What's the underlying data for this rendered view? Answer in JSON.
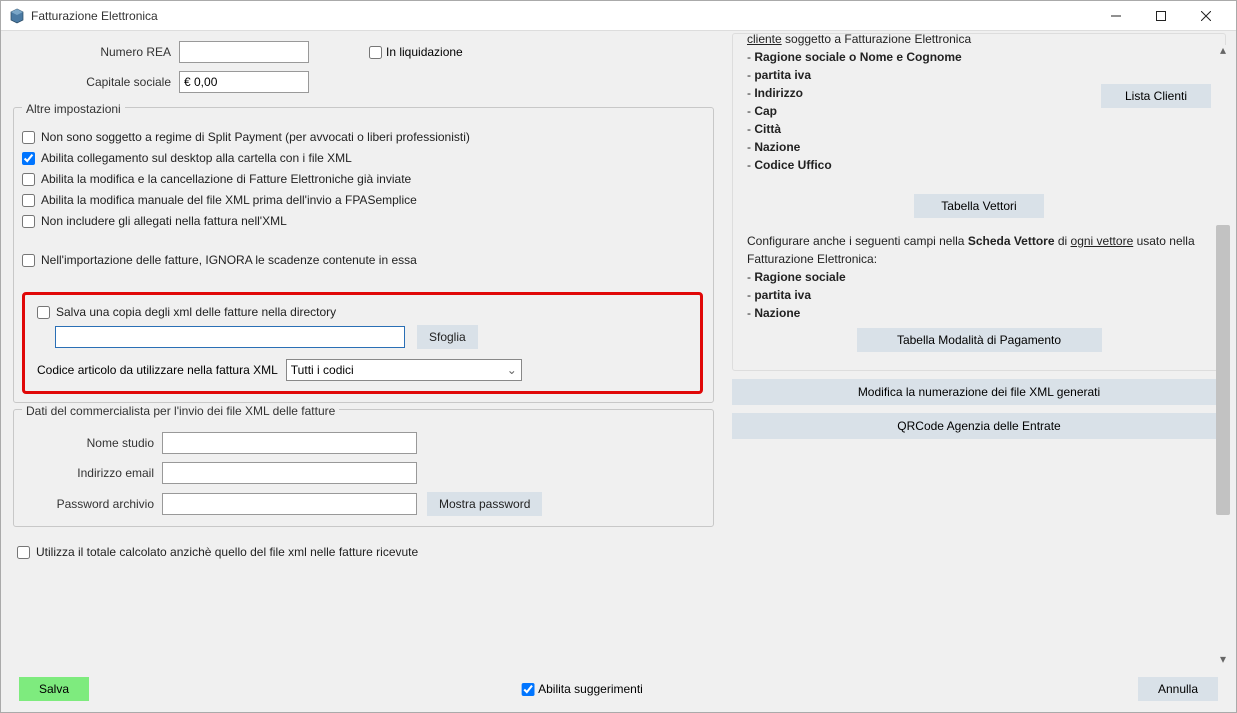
{
  "window": {
    "title": "Fatturazione Elettronica"
  },
  "top_form": {
    "numero_rea_label": "Numero REA",
    "numero_rea_value": "",
    "capitale_label": "Capitale sociale",
    "capitale_value": "€ 0,00",
    "in_liq_label": "In liquidazione"
  },
  "altre_group": {
    "title": "Altre impostazioni",
    "cb1": "Non sono soggetto a regime di Split Payment (per avvocati o liberi professionisti)",
    "cb2": "Abilita collegamento sul desktop alla cartella con i file XML",
    "cb3": "Abilita la modifica e la cancellazione di Fatture Elettroniche già inviate",
    "cb4": "Abilita la modifica manuale del file XML prima dell'invio a FPASemplice",
    "cb5": "Non includere gli allegati nella fattura nell'XML",
    "cb6": "Nell'importazione delle fatture, IGNORA le scadenze contenute in essa"
  },
  "xml_copy": {
    "cb_label": "Salva una copia degli xml delle fatture nella directory",
    "dir_value": "",
    "browse_btn": "Sfoglia",
    "codice_label": "Codice articolo da utilizzare nella fattura XML",
    "select_value": "Tutti i codici"
  },
  "commercialista": {
    "title": "Dati del commercialista per l'invio dei file XML delle fatture",
    "nome_label": "Nome studio",
    "nome_value": "",
    "email_label": "Indirizzo email",
    "email_value": "",
    "pwd_label": "Password archivio",
    "pwd_value": "",
    "show_pwd_btn": "Mostra password"
  },
  "bottom_cb": "Utilizza il totale calcolato anzichè quello del file xml nelle fatture ricevute",
  "footer": {
    "save": "Salva",
    "hints": "Abilita suggerimenti",
    "cancel": "Annulla"
  },
  "right": {
    "intro_partial": " soggetto a Fatturazione Elettronica",
    "cliente_word": "cliente",
    "bullets_top": [
      "Ragione sociale o Nome e Cognome",
      "partita iva",
      "Indirizzo",
      "Cap",
      "Città",
      "Nazione",
      "Codice Uffico"
    ],
    "lista_clienti_btn": "Lista Clienti",
    "tabella_vettori_btn": "Tabella Vettori",
    "config_text_pre": "Configurare anche i seguenti campi nella ",
    "scheda_vettore": "Scheda Vettore",
    "config_text_mid": " di ",
    "ogni_vettore": "ogni vettore",
    "config_text_post": " usato nella Fatturazione Elettronica:",
    "bullets_bottom": [
      "Ragione sociale",
      "partita iva",
      "Nazione"
    ],
    "modalita_btn": "Tabella Modalità di Pagamento",
    "modifica_num_btn": "Modifica la numerazione dei file XML generati",
    "qrcode_btn": "QRCode Agenzia delle Entrate"
  }
}
